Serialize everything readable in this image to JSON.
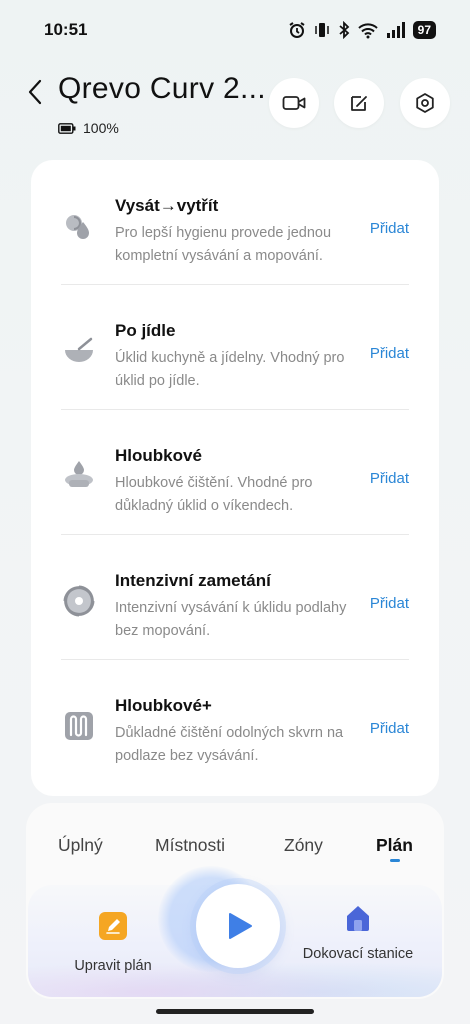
{
  "status_bar": {
    "time": "10:51",
    "battery_level": "97"
  },
  "header": {
    "title": "Qrevo Curv 2...",
    "battery": "100%",
    "icons": [
      "video-icon",
      "map-edit-icon",
      "settings-icon"
    ]
  },
  "plans": [
    {
      "title": "Vysát→vytřít",
      "description": "Pro lepší hygienu provede jednou kompletní vysávání a mopování.",
      "action": "Přidat",
      "icon": "vacuum-mop-icon"
    },
    {
      "title": "Po jídle",
      "description": "Úklid kuchyně a jídelny. Vhodný pro úklid po jídle.",
      "action": "Přidat",
      "icon": "bowl-icon"
    },
    {
      "title": "Hloubkové",
      "description": "Hloubkové čištění. Vhodné pro důkladný úklid o víkendech.",
      "action": "Přidat",
      "icon": "deep-clean-icon"
    },
    {
      "title": "Intenzivní zametání",
      "description": "Intenzivní vysávání k úklidu podlahy bez mopování.",
      "action": "Přidat",
      "icon": "sweep-swirl-icon"
    },
    {
      "title": "Hloubkové+",
      "description": "Důkladné čištění odolných skvrn na podlaze bez vysávání.",
      "action": "Přidat",
      "icon": "deep-plus-icon"
    }
  ],
  "tabs": [
    {
      "label": "Úplný"
    },
    {
      "label": "Místnosti"
    },
    {
      "label": "Zóny"
    },
    {
      "label": "Plán",
      "active": true
    }
  ],
  "actions": {
    "edit_plan": "Upravit plán",
    "dock": "Dokovací stanice"
  },
  "colors": {
    "accent": "#2a86d6",
    "edit_icon": "#f5a623",
    "dock_icon": "#4a66d8",
    "play": "#3f7fe6"
  }
}
